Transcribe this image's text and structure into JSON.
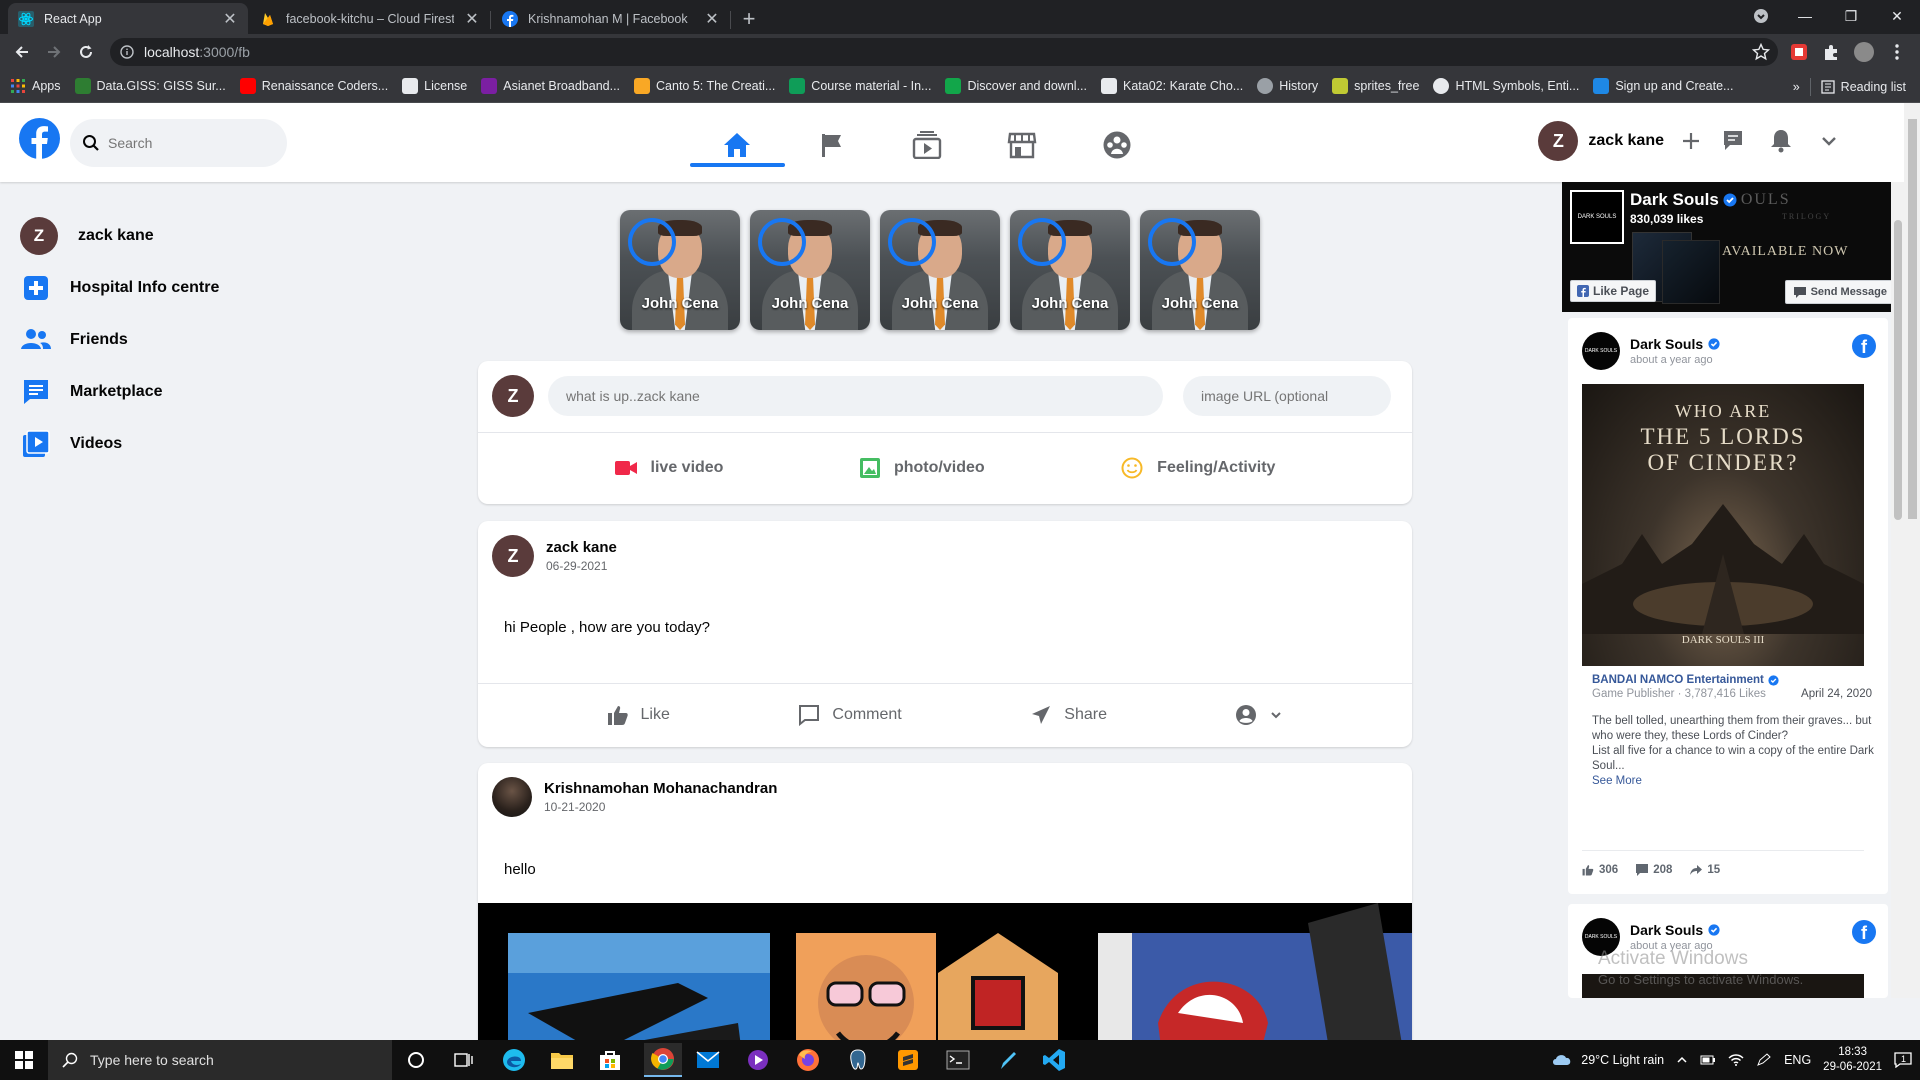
{
  "browser": {
    "tabs": [
      {
        "title": "React App",
        "active": true,
        "favicon": "react-icon"
      },
      {
        "title": "facebook-kitchu – Cloud Firestore",
        "active": false,
        "favicon": "firebase-icon"
      },
      {
        "title": "Krishnamohan M | Facebook",
        "active": false,
        "favicon": "facebook-icon"
      }
    ],
    "url_host": "localhost",
    "url_path": ":3000/fb",
    "bookmarks": [
      {
        "label": "Apps",
        "color": "#e8453c"
      },
      {
        "label": "Data.GISS: GISS Sur...",
        "color": "#2e7d32"
      },
      {
        "label": "Renaissance Coders...",
        "color": "#ff0000"
      },
      {
        "label": "License",
        "color": "#e8eaed"
      },
      {
        "label": "Asianet Broadband...",
        "color": "#7b1fa2"
      },
      {
        "label": "Canto 5: The Creati...",
        "color": "#f9a825"
      },
      {
        "label": "Course material - In...",
        "color": "#0f9d58"
      },
      {
        "label": "Discover and downl...",
        "color": "#12a64a"
      },
      {
        "label": "Kata02: Karate Cho...",
        "color": "#e8eaed"
      },
      {
        "label": "History",
        "color": "#9aa0a6"
      },
      {
        "label": "sprites_free",
        "color": "#c0ca33"
      },
      {
        "label": "HTML Symbols, Enti...",
        "color": "#e8eaed"
      },
      {
        "label": "Sign up and Create...",
        "color": "#1e88e5"
      }
    ],
    "bookmarks_more": "»",
    "reading_list": "Reading list"
  },
  "fb": {
    "search_placeholder": "Search",
    "user_initial": "Z",
    "user_name": "zack kane",
    "sidebar": [
      {
        "label": "zack kane",
        "icon": "avatar"
      },
      {
        "label": "Hospital Info centre",
        "icon": "hospital-icon"
      },
      {
        "label": "Friends",
        "icon": "friends-icon"
      },
      {
        "label": "Marketplace",
        "icon": "marketplace-icon"
      },
      {
        "label": "Videos",
        "icon": "videos-icon"
      }
    ],
    "stories": [
      {
        "name": "John Cena"
      },
      {
        "name": "John Cena"
      },
      {
        "name": "John Cena"
      },
      {
        "name": "John Cena"
      },
      {
        "name": "John Cena"
      }
    ],
    "composer": {
      "placeholder": "what is up..zack kane",
      "image_placeholder": "image URL (optional",
      "options": [
        "live video",
        "photo/video",
        "Feeling/Activity"
      ]
    },
    "posts": [
      {
        "author": "zack kane",
        "initial": "Z",
        "date": "06-29-2021",
        "text": "hi People , how are you today?"
      },
      {
        "author": "Krishnamohan Mohanachandran",
        "date": "10-21-2020",
        "text": "hello"
      }
    ],
    "actions": {
      "like": "Like",
      "comment": "Comment",
      "share": "Share"
    }
  },
  "ad": {
    "page_name": "Dark Souls",
    "likes": "830,039 likes",
    "logo_text": "DARK SOULS",
    "banner_fragment": "OULS",
    "banner_sub": "TRILOGY",
    "available": "AVAILABLE NOW",
    "like_page": "Like Page",
    "send_message": "Send Message",
    "feed": {
      "name": "Dark Souls",
      "time": "about a year ago",
      "image_line1": "WHO ARE",
      "image_line2": "THE 5 LORDS",
      "image_line3": "OF CINDER?",
      "image_footer": "DARK SOULS III",
      "publisher": "BANDAI NAMCO Entertainment",
      "publisher_meta": "Game Publisher · 3,787,416 Likes",
      "publisher_date": "April 24, 2020",
      "text1": "The bell tolled, unearthing them from their graves... but who were they, these Lords of Cinder?",
      "text2": "List all five for a chance to win a copy of the entire Dark Soul...",
      "see_more": "See More",
      "likes": "306",
      "comments": "208",
      "shares": "15"
    },
    "feed2": {
      "name": "Dark Souls",
      "time": "about a year ago"
    },
    "watermark1": "Activate Windows",
    "watermark2": "Go to Settings to activate Windows."
  },
  "taskbar": {
    "search_placeholder": "Type here to search",
    "weather": "29°C  Light rain",
    "lang": "ENG",
    "time": "18:33",
    "date": "29-06-2021",
    "notif_count": "1"
  },
  "colors": {
    "fb_blue": "#1877f2",
    "avatar": "#5a3b3b",
    "chrome_dark": "#202124"
  }
}
